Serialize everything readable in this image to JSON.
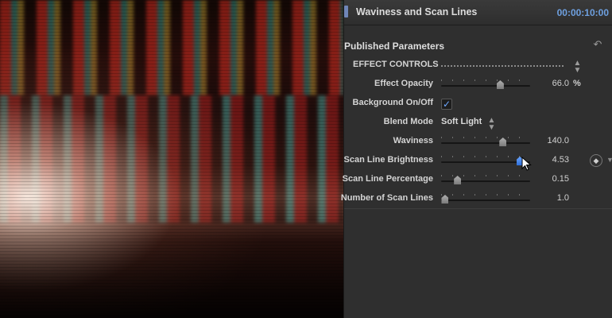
{
  "header": {
    "title": "Waviness and Scan Lines",
    "timecode": "00:00:10:00"
  },
  "section": {
    "title": "Published Parameters"
  },
  "params": {
    "effect_controls": {
      "label": "EFFECT CONTROLS"
    },
    "effect_opacity": {
      "label": "Effect Opacity",
      "value": "66.0",
      "unit": "%",
      "level": 0.66
    },
    "background_onoff": {
      "label": "Background On/Off",
      "checked": true,
      "check_glyph": "✓"
    },
    "blend_mode": {
      "label": "Blend Mode",
      "value": "Soft Light"
    },
    "waviness": {
      "label": "Waviness",
      "value": "140.0",
      "level": 0.69
    },
    "scan_line_brightness": {
      "label": "Scan Line Brightness",
      "value": "4.53",
      "level": 0.88
    },
    "scan_line_percentage": {
      "label": "Scan Line Percentage",
      "value": "0.15",
      "level": 0.18
    },
    "number_of_scan_lines": {
      "label": "Number of Scan Lines",
      "value": "1.0",
      "level": 0.04
    }
  },
  "icons": {
    "reset": "↶",
    "stepper": "▲▼",
    "keyframe": "◆",
    "chevron": "▼"
  },
  "colors": {
    "accent": "#6ea0e0",
    "panel_bg": "#2f2f2f"
  }
}
